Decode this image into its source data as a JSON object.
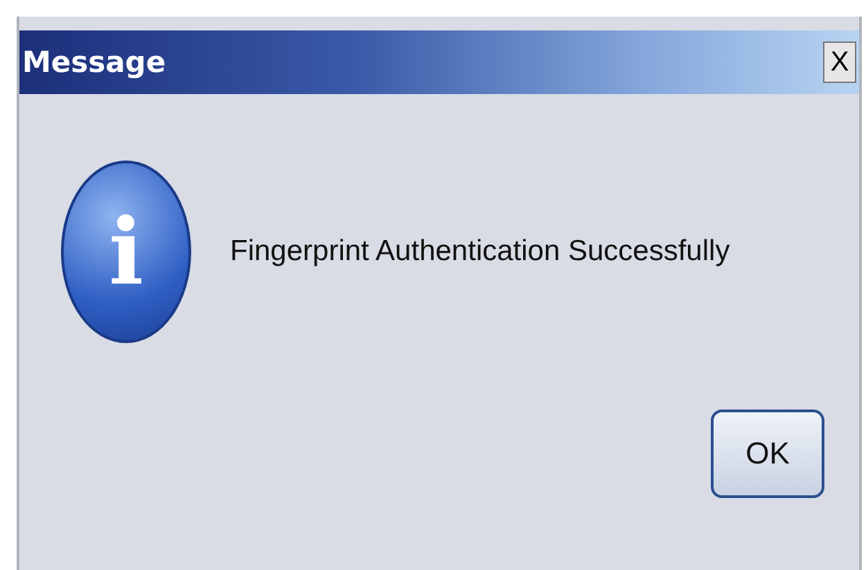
{
  "window": {
    "title": "Message",
    "close_label": "X"
  },
  "message": "Fingerprint Authentication Successfully",
  "icon": {
    "glyph": "i"
  },
  "buttons": [
    "OK"
  ]
}
